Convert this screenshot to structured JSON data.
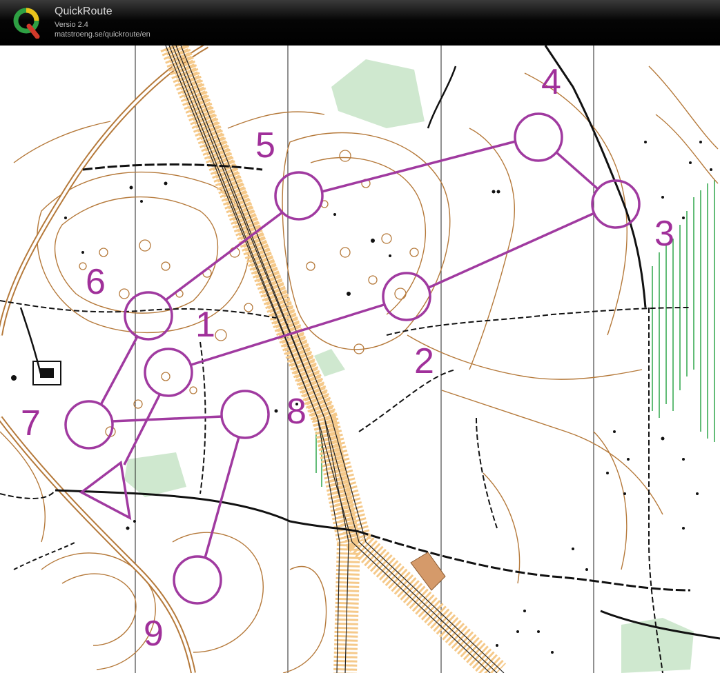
{
  "app": {
    "name": "QuickRoute",
    "version": "Versio 2.4",
    "url": "matstroeng.se/quickroute/en"
  },
  "course": {
    "color": "#a03aa0",
    "controls": [
      {
        "label": "1"
      },
      {
        "label": "2"
      },
      {
        "label": "3"
      },
      {
        "label": "4"
      },
      {
        "label": "5"
      },
      {
        "label": "6"
      },
      {
        "label": "7"
      },
      {
        "label": "8"
      },
      {
        "label": "9"
      }
    ]
  },
  "colors": {
    "contour": "#b5793a",
    "vegetation": "#cfe8cf",
    "road": "#e8b86a",
    "track": "#111111",
    "marsh": "#2fa64a"
  }
}
